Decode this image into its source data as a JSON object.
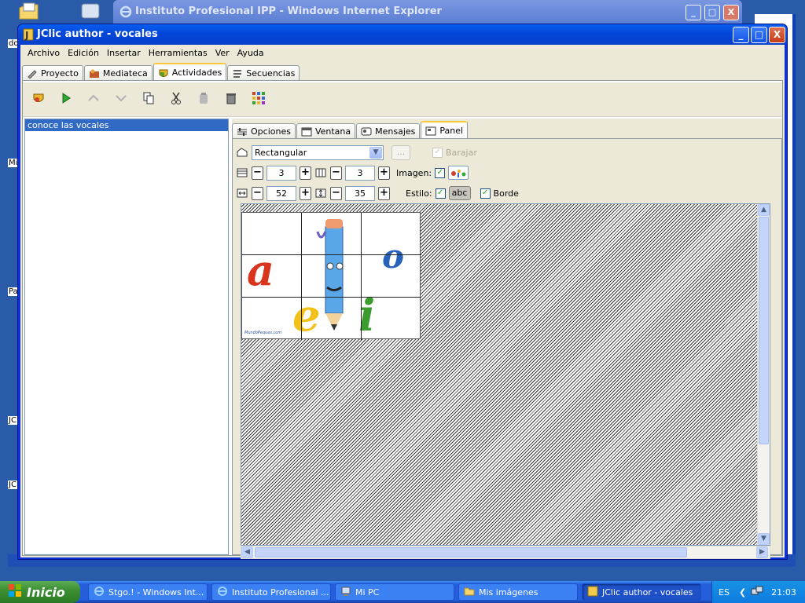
{
  "desktop": {
    "side_labels": [
      "do",
      "Mi",
      "Pa",
      "JC",
      "JC"
    ]
  },
  "ie_window": {
    "title": "Instituto Profesional IPP - Windows Internet Explorer"
  },
  "window": {
    "title": "JClic author - vocales",
    "minimize": "_",
    "maximize": "□",
    "close": "X"
  },
  "menu": [
    "Archivo",
    "Edición",
    "Insertar",
    "Herramientas",
    "Ver",
    "Ayuda"
  ],
  "main_tabs": [
    {
      "label": "Proyecto",
      "icon": "wrench-icon"
    },
    {
      "label": "Mediateca",
      "icon": "media-icon"
    },
    {
      "label": "Actividades",
      "icon": "shield-icon",
      "active": true
    },
    {
      "label": "Secuencias",
      "icon": "sequence-icon"
    }
  ],
  "toolbar": {
    "buttons": [
      "new-activity",
      "play",
      "move-up",
      "move-down",
      "copy",
      "cut",
      "paste",
      "delete",
      "grid"
    ]
  },
  "activity_list": {
    "items": [
      "conoce las vocales"
    ]
  },
  "sub_tabs": [
    {
      "label": "Opciones",
      "icon": "options-icon"
    },
    {
      "label": "Ventana",
      "icon": "window-icon"
    },
    {
      "label": "Mensajes",
      "icon": "messages-icon"
    },
    {
      "label": "Panel",
      "icon": "panel-icon",
      "active": true
    }
  ],
  "panel": {
    "shape": "Rectangular",
    "dots": "...",
    "shuffle_label": "Barajar",
    "rows": "3",
    "cols": "3",
    "image_label": "Imagen:",
    "width": "52",
    "height": "35",
    "style_label": "Estilo:",
    "style_btn": "abc",
    "border_label": "Borde"
  },
  "puzzle": {
    "letters": [
      "a",
      "e",
      "i",
      "o",
      "u"
    ],
    "watermark": "MundoPeques.com"
  },
  "taskbar": {
    "start": "Inicio",
    "tasks": [
      {
        "label": "Stgo.! - Windows Int...",
        "icon": "ie-icon"
      },
      {
        "label": "Instituto Profesional ...",
        "icon": "ie-icon"
      },
      {
        "label": "Mi PC",
        "icon": "computer-icon"
      },
      {
        "label": "Mis imágenes",
        "icon": "folder-icon"
      },
      {
        "label": "JClic author - vocales",
        "icon": "jclic-icon",
        "active": true
      }
    ],
    "language": "ES",
    "time": "21:03"
  },
  "colors": {
    "title_blue": "#0a5ef0",
    "selection": "#316ac5",
    "start_green": "#3c8f32",
    "tab_highlight": "#ffc83c"
  }
}
